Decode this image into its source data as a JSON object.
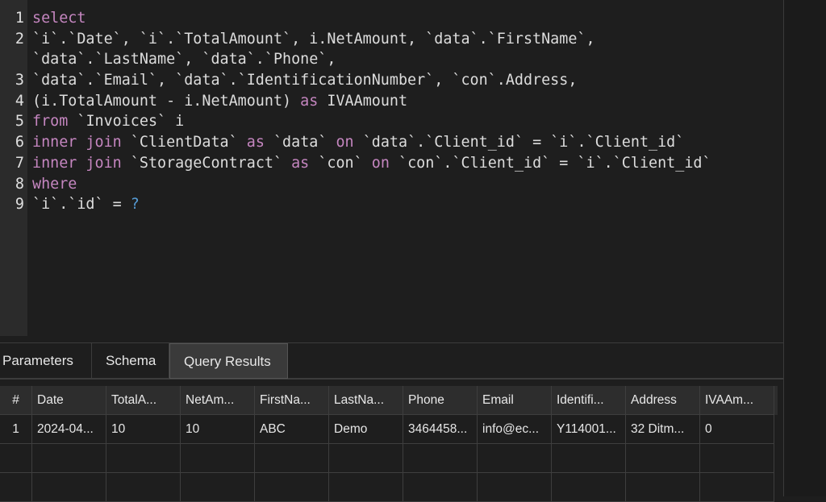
{
  "editor": {
    "lines": [
      {
        "ln": "1",
        "tokens": [
          {
            "t": "select",
            "c": "kw"
          }
        ]
      },
      {
        "ln": "2",
        "tokens": [
          {
            "t": "`i`.`Date`, `i`.`TotalAmount`, i.NetAmount, `data`.`FirstName`,",
            "c": ""
          }
        ]
      },
      {
        "ln": "",
        "tokens": [
          {
            "t": "`data`.`LastName`, `data`.`Phone`,",
            "c": ""
          }
        ]
      },
      {
        "ln": "3",
        "tokens": [
          {
            "t": "`data`.`Email`, `data`.`IdentificationNumber`, `con`.Address,",
            "c": ""
          }
        ]
      },
      {
        "ln": "4",
        "tokens": [
          {
            "t": "(i.TotalAmount - i.NetAmount) ",
            "c": ""
          },
          {
            "t": "as",
            "c": "kw"
          },
          {
            "t": " IVAAmount",
            "c": ""
          }
        ]
      },
      {
        "ln": "5",
        "tokens": [
          {
            "t": "from",
            "c": "kw"
          },
          {
            "t": " `Invoices` i",
            "c": ""
          }
        ]
      },
      {
        "ln": "6",
        "tokens": [
          {
            "t": "inner join",
            "c": "kw"
          },
          {
            "t": " `ClientData` ",
            "c": ""
          },
          {
            "t": "as",
            "c": "kw"
          },
          {
            "t": " `data` ",
            "c": ""
          },
          {
            "t": "on",
            "c": "kw"
          },
          {
            "t": " `data`.`Client_id` = `i`.`Client_id`",
            "c": ""
          }
        ]
      },
      {
        "ln": "7",
        "tokens": [
          {
            "t": "inner join",
            "c": "kw"
          },
          {
            "t": " `StorageContract` ",
            "c": ""
          },
          {
            "t": "as",
            "c": "kw"
          },
          {
            "t": " `con` ",
            "c": ""
          },
          {
            "t": "on",
            "c": "kw"
          },
          {
            "t": " `con`.`Client_id` = `i`.`Client_id`",
            "c": ""
          }
        ]
      },
      {
        "ln": "8",
        "tokens": [
          {
            "t": "where",
            "c": "kw"
          }
        ]
      },
      {
        "ln": "9",
        "tokens": [
          {
            "t": "`i`.`id` = ",
            "c": ""
          },
          {
            "t": "?",
            "c": "q"
          }
        ]
      }
    ]
  },
  "tabs": [
    {
      "label": "Parameters",
      "name": "tab-parameters",
      "active": false
    },
    {
      "label": "Schema",
      "name": "tab-schema",
      "active": false
    },
    {
      "label": "Query Results",
      "name": "tab-query-results",
      "active": true
    }
  ],
  "results": {
    "columns": [
      "#",
      "Date",
      "TotalA...",
      "NetAm...",
      "FirstNa...",
      "LastNa...",
      "Phone",
      "Email",
      "Identifi...",
      "Address",
      "IVAAm..."
    ],
    "rows": [
      [
        "1",
        "2024-04...",
        "10",
        "10",
        "ABC",
        "Demo",
        "3464458...",
        "info@ec...",
        "Y114001...",
        "32 Ditm...",
        "0"
      ]
    ],
    "empty_rows": 2
  },
  "colors": {
    "keyword": "#c586c0",
    "param": "#569cd6",
    "text": "#dcdcdc",
    "background": "#1e1e1e"
  }
}
